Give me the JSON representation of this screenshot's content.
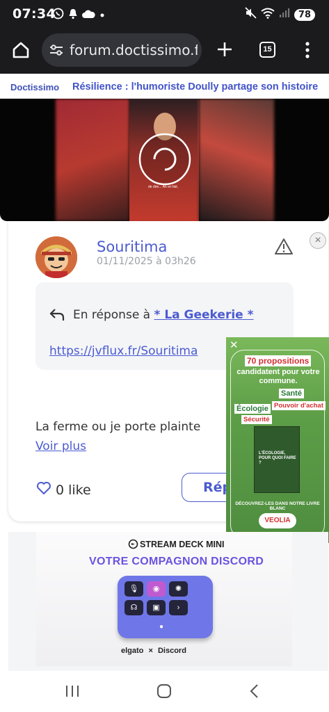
{
  "status_bar": {
    "time": "07:34",
    "battery": "78",
    "icons": [
      "whatsapp-icon",
      "notification-bell-icon",
      "cloud-icon",
      "dot-icon",
      "mute-icon",
      "wifi-icon",
      "signal-icon",
      "battery-icon"
    ]
  },
  "browser": {
    "url": "forum.doctissimo.fr/",
    "tab_count": "15",
    "icons": [
      "home-icon",
      "site-settings-icon",
      "new-tab-icon",
      "tab-switcher-icon",
      "menu-icon"
    ]
  },
  "site_header": {
    "logo": "Doctissimo",
    "article_title": "Résilience : l'humoriste Doully partage son histoire"
  },
  "video": {
    "caption": "de dire... Ah en fait,"
  },
  "post": {
    "author": "Souritima",
    "date": "01/11/2025 à 03h26",
    "reply_prefix": "En réponse à",
    "reply_to": "* La Geekerie *",
    "quote_link": "https://jvflux.fr/Souritima",
    "body": "La ferme ou je porte plainte",
    "see_more": "Voir plus",
    "likes": "0 like",
    "reply_button": "Répondre"
  },
  "veolia_ad": {
    "headline": "70 propositions",
    "subheadline": "candidatent pour votre commune.",
    "tags": [
      "Santé",
      "Pouvoir d'achat",
      "Écologie",
      "Sécurité"
    ],
    "book_title": "L'ÉCOLOGIE, POUR QUOI FAIRE ?",
    "cta": "DÉCOUVREZ-LES DANS NOTRE LIVRE BLANC",
    "brand": "VEOLIA"
  },
  "stream_deck_ad": {
    "product": "STREAM DECK MINI",
    "tagline": "VOTRE COMPAGNON DISCORD",
    "brand_1": "elgato",
    "separator": "×",
    "brand_2": "Discord"
  },
  "nav_bar": {
    "icons": [
      "recent-apps-icon",
      "home-nav-icon",
      "back-icon"
    ]
  },
  "colors": {
    "accent": "#4b5bd1",
    "dark_bar": "#1b1b1e",
    "ad_red": "#d42f2f",
    "ad_green": "#5c9d47",
    "discord_purple": "#6b52e0"
  }
}
